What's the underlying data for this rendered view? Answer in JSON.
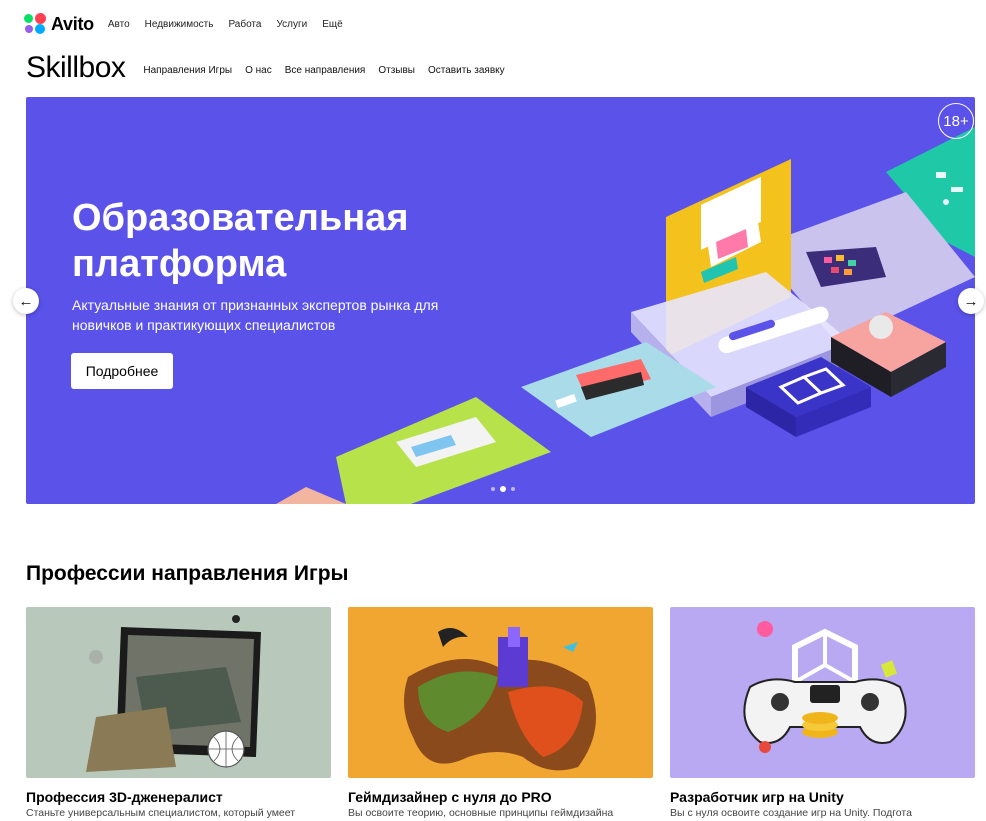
{
  "avito": {
    "brand": "Avito",
    "nav": [
      "Авто",
      "Недвижимость",
      "Работа",
      "Услуги",
      "Ещё"
    ]
  },
  "skillbox": {
    "brand": "Skillbox",
    "nav": [
      "Направления Игры",
      "О нас",
      "Все направления",
      "Отзывы",
      "Оставить заявку"
    ]
  },
  "hero": {
    "title": "Образовательная платформа",
    "subtitle": "Актуальные знания от признанных экспертов рынка для новичков и практикующих специалистов",
    "button": "Подробнее",
    "age_badge": "18+",
    "bg_color": "#5a52e9",
    "slide_count": 3,
    "active_slide": 2
  },
  "section": {
    "title": "Профессии направления Игры"
  },
  "cards": [
    {
      "title": "Профессия 3D-дженералист",
      "desc": "Станьте универсальным специалистом, который умеет",
      "bg": "#b8c9bb"
    },
    {
      "title": "Геймдизайнер с нуля до PRO",
      "desc": "Вы освоите теорию, основные принципы геймдизайна",
      "bg": "#f0a630"
    },
    {
      "title": "Разработчик игр на Unity",
      "desc": "Вы с нуля освоите создание игр на Unity. Подгота",
      "bg": "#b9a8f2"
    }
  ],
  "icons": {
    "arrow_left": "←",
    "arrow_right": "→"
  }
}
